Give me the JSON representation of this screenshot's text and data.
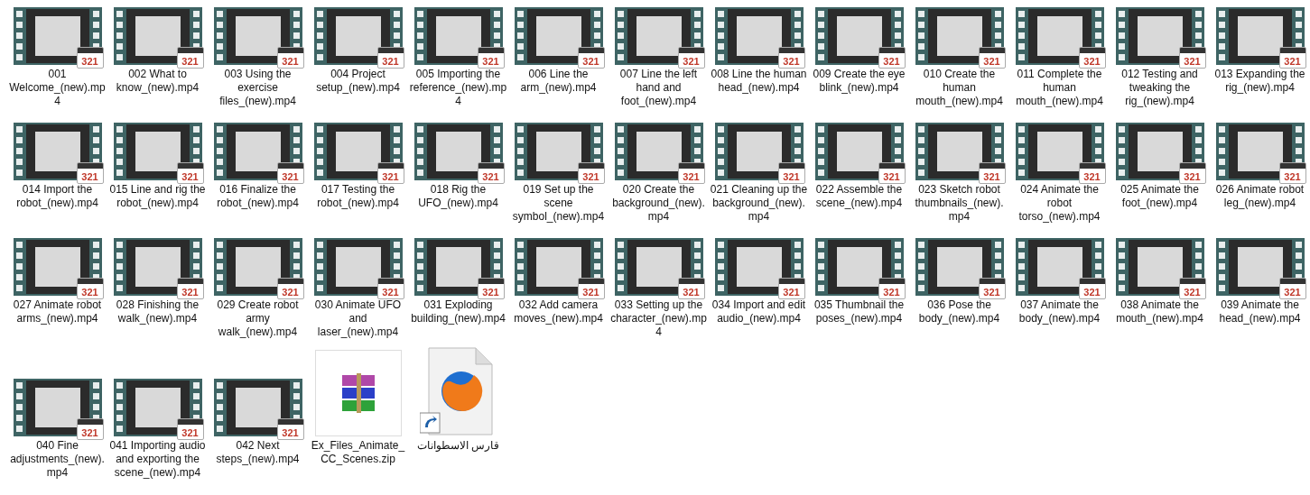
{
  "items": [
    {
      "kind": "video",
      "label": "001 Welcome_(new).mp4",
      "badge": "321"
    },
    {
      "kind": "video",
      "label": "002 What to know_(new).mp4",
      "badge": "321"
    },
    {
      "kind": "video",
      "label": "003 Using the exercise files_(new).mp4",
      "badge": "321"
    },
    {
      "kind": "video",
      "label": "004 Project setup_(new).mp4",
      "badge": "321"
    },
    {
      "kind": "video",
      "label": "005 Importing the reference_(new).mp4",
      "badge": "321"
    },
    {
      "kind": "video",
      "label": "006 Line the arm_(new).mp4",
      "badge": "321"
    },
    {
      "kind": "video",
      "label": "007 Line the left hand and foot_(new).mp4",
      "badge": "321"
    },
    {
      "kind": "video",
      "label": "008 Line the human head_(new).mp4",
      "badge": "321"
    },
    {
      "kind": "video",
      "label": "009 Create the eye blink_(new).mp4",
      "badge": "321"
    },
    {
      "kind": "video",
      "label": "010 Create the human mouth_(new).mp4",
      "badge": "321"
    },
    {
      "kind": "video",
      "label": "011 Complete the human mouth_(new).mp4",
      "badge": "321"
    },
    {
      "kind": "video",
      "label": "012 Testing and tweaking the rig_(new).mp4",
      "badge": "321"
    },
    {
      "kind": "video",
      "label": "013 Expanding the rig_(new).mp4",
      "badge": "321"
    },
    {
      "kind": "video",
      "label": "014 Import the robot_(new).mp4",
      "badge": "321"
    },
    {
      "kind": "video",
      "label": "015 Line and rig the robot_(new).mp4",
      "badge": "321"
    },
    {
      "kind": "video",
      "label": "016 Finalize the robot_(new).mp4",
      "badge": "321"
    },
    {
      "kind": "video",
      "label": "017 Testing the robot_(new).mp4",
      "badge": "321"
    },
    {
      "kind": "video",
      "label": "018 Rig the UFO_(new).mp4",
      "badge": "321"
    },
    {
      "kind": "video",
      "label": "019 Set up the scene symbol_(new).mp4",
      "badge": "321"
    },
    {
      "kind": "video",
      "label": "020 Create the background_(new).mp4",
      "badge": "321"
    },
    {
      "kind": "video",
      "label": "021 Cleaning up the background_(new).mp4",
      "badge": "321"
    },
    {
      "kind": "video",
      "label": "022 Assemble the scene_(new).mp4",
      "badge": "321"
    },
    {
      "kind": "video",
      "label": "023 Sketch robot thumbnails_(new).mp4",
      "badge": "321"
    },
    {
      "kind": "video",
      "label": "024 Animate the robot torso_(new).mp4",
      "badge": "321"
    },
    {
      "kind": "video",
      "label": "025 Animate the foot_(new).mp4",
      "badge": "321"
    },
    {
      "kind": "video",
      "label": "026 Animate robot leg_(new).mp4",
      "badge": "321"
    },
    {
      "kind": "video",
      "label": "027 Animate robot arms_(new).mp4",
      "badge": "321"
    },
    {
      "kind": "video",
      "label": "028 Finishing the walk_(new).mp4",
      "badge": "321"
    },
    {
      "kind": "video",
      "label": "029 Create robot army walk_(new).mp4",
      "badge": "321"
    },
    {
      "kind": "video",
      "label": "030 Animate UFO and laser_(new).mp4",
      "badge": "321"
    },
    {
      "kind": "video",
      "label": "031 Exploding building_(new).mp4",
      "badge": "321"
    },
    {
      "kind": "video",
      "label": "032 Add camera moves_(new).mp4",
      "badge": "321"
    },
    {
      "kind": "video",
      "label": "033 Setting up the character_(new).mp4",
      "badge": "321"
    },
    {
      "kind": "video",
      "label": "034 Import and edit audio_(new).mp4",
      "badge": "321"
    },
    {
      "kind": "video",
      "label": "035 Thumbnail the poses_(new).mp4",
      "badge": "321"
    },
    {
      "kind": "video",
      "label": "036 Pose the body_(new).mp4",
      "badge": "321"
    },
    {
      "kind": "video",
      "label": "037 Animate the body_(new).mp4",
      "badge": "321"
    },
    {
      "kind": "video",
      "label": "038 Animate the mouth_(new).mp4",
      "badge": "321"
    },
    {
      "kind": "video",
      "label": "039 Animate the head_(new).mp4",
      "badge": "321"
    },
    {
      "kind": "video",
      "label": "040 Fine adjustments_(new).mp4",
      "badge": "321"
    },
    {
      "kind": "video",
      "label": "041 Importing audio and exporting the scene_(new).mp4",
      "badge": "321"
    },
    {
      "kind": "video",
      "label": "042 Next steps_(new).mp4",
      "badge": "321"
    },
    {
      "kind": "archive",
      "label": "Ex_Files_Animate_CC_Scenes.zip"
    },
    {
      "kind": "shortcut",
      "label": "قارس الاسطوانات"
    }
  ]
}
